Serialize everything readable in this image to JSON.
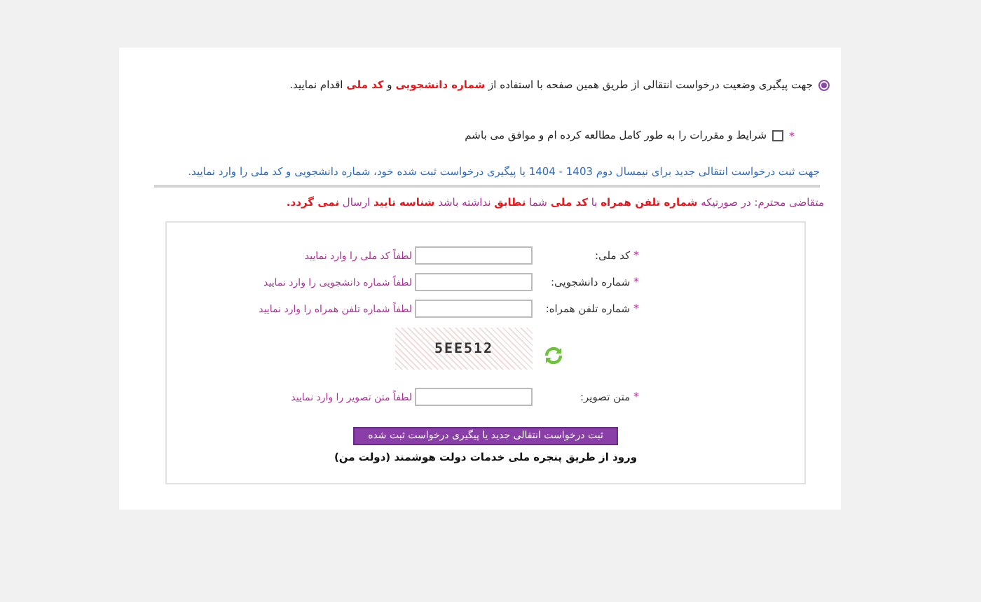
{
  "tracking_option": {
    "selected": true,
    "segments": [
      {
        "text": "جهت پیگیری وضعیت درخواست انتقالی از طریق همین صفحه با استفاده از",
        "emphasis": false
      },
      {
        "text": "شماره دانشجویی",
        "emphasis": true
      },
      {
        "text": "و",
        "emphasis": false
      },
      {
        "text": "کد ملی",
        "emphasis": true
      },
      {
        "text": "اقدام نمایید.",
        "emphasis": false
      }
    ]
  },
  "terms": {
    "required_mark": "*",
    "checked": false,
    "label": "شرایط و مقررات را به طور کامل مطالعه کرده ام و موافق می باشم"
  },
  "info_text": "جهت ثبت درخواست انتقالی جدید برای نیمسال دوم 1403 - 1404 یا پیگیری درخواست ثبت شده خود، شماره دانشجویی و کد ملی را وارد نمایید.",
  "notice": [
    {
      "text": "متقاضی محترم: در صورتیکه",
      "emphasis": false
    },
    {
      "text": "شماره تلفن همراه",
      "emphasis": true
    },
    {
      "text": "با",
      "emphasis": false
    },
    {
      "text": "کد ملی",
      "emphasis": true
    },
    {
      "text": "شما",
      "emphasis": false
    },
    {
      "text": "تطابق",
      "emphasis": true
    },
    {
      "text": "نداشته باشد",
      "emphasis": false
    },
    {
      "text": "شناسه تایید",
      "emphasis": true
    },
    {
      "text": "ارسال",
      "emphasis": false
    },
    {
      "text": "نمی گردد.",
      "emphasis": true
    }
  ],
  "form": {
    "fields": [
      {
        "required_mark": "*",
        "label": "کد ملی:",
        "hint": "لطفاً کد ملی را وارد نمایید"
      },
      {
        "required_mark": "*",
        "label": "شماره دانشجویی:",
        "hint": "لطفاً شماره دانشجویی را وارد نمایید"
      },
      {
        "required_mark": "*",
        "label": "شماره تلفن همراه:",
        "hint": "لطفاً شماره تلفن همراه را وارد نمایید"
      }
    ],
    "captcha": {
      "code": "5EE512"
    },
    "captcha_field": {
      "required_mark": "*",
      "label": "متن تصویر:",
      "hint": "لطفاً متن تصویر را وارد نمایید"
    },
    "submit_button": "ثبت درخواست انتقالی جدید یا پیگیری درخواست ثبت شده",
    "gov_link": "ورود از طریق پنجره ملی خدمات دولت هوشمند (دولت من)"
  }
}
